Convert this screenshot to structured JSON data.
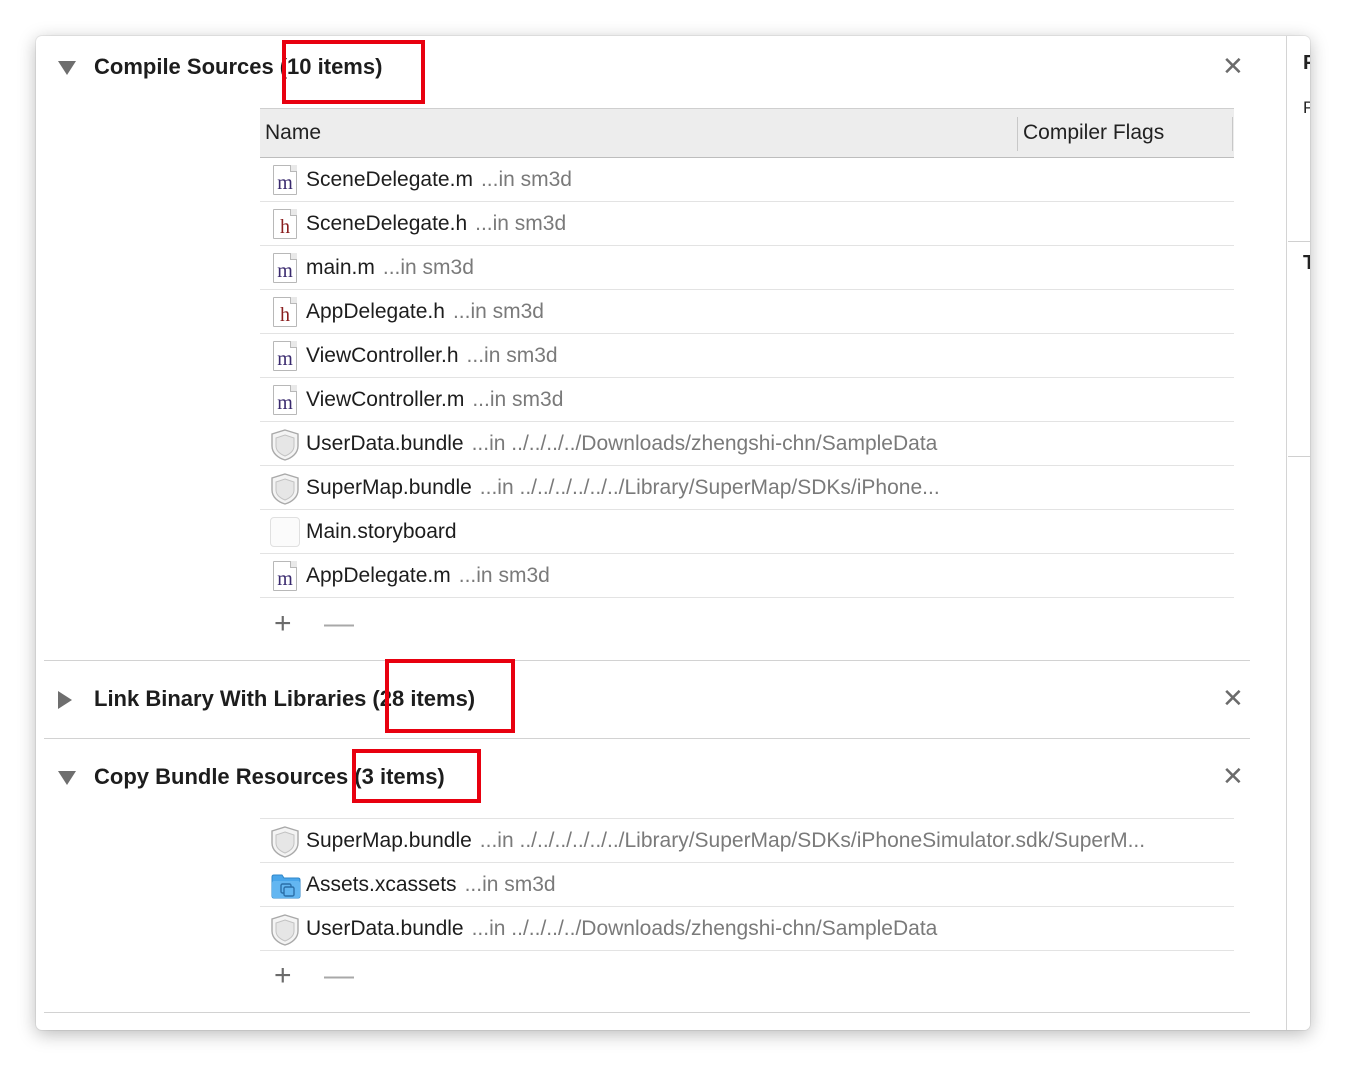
{
  "sections": {
    "compile_sources": {
      "title": "Compile Sources",
      "count": "(10 items)",
      "expanded": true,
      "columns": {
        "name": "Name",
        "compiler_flags": "Compiler Flags"
      },
      "rows": [
        {
          "icon": "objc-m-file-icon",
          "name": "SceneDelegate.m",
          "path": "...in sm3d"
        },
        {
          "icon": "header-h-file-icon",
          "name": "SceneDelegate.h",
          "path": "...in sm3d"
        },
        {
          "icon": "objc-m-file-icon",
          "name": "main.m",
          "path": "...in sm3d"
        },
        {
          "icon": "header-h-file-icon",
          "name": "AppDelegate.h",
          "path": "...in sm3d"
        },
        {
          "icon": "objc-m-file-icon",
          "name": "ViewController.h",
          "path": "...in sm3d"
        },
        {
          "icon": "objc-m-file-icon",
          "name": "ViewController.m",
          "path": "...in sm3d"
        },
        {
          "icon": "bundle-icon",
          "name": "UserData.bundle",
          "path": "...in ../../../../Downloads/zhengshi-chn/SampleData"
        },
        {
          "icon": "bundle-icon",
          "name": "SuperMap.bundle",
          "path": "...in ../../../../../../Library/SuperMap/SDKs/iPhone..."
        },
        {
          "icon": "storyboard-icon",
          "name": "Main.storyboard",
          "path": ""
        },
        {
          "icon": "objc-m-file-icon",
          "name": "AppDelegate.m",
          "path": "...in sm3d"
        }
      ],
      "add_label": "+",
      "remove_label": "—"
    },
    "link_binary": {
      "title": "Link Binary With Libraries",
      "count": "(28 items)",
      "expanded": false
    },
    "copy_bundle": {
      "title": "Copy Bundle Resources",
      "count": "(3 items)",
      "expanded": true,
      "rows": [
        {
          "icon": "bundle-icon",
          "name": "SuperMap.bundle",
          "path": "...in ../../../../../../Library/SuperMap/SDKs/iPhoneSimulator.sdk/SuperM..."
        },
        {
          "icon": "assets-folder-icon",
          "name": "Assets.xcassets",
          "path": "...in sm3d"
        },
        {
          "icon": "bundle-icon",
          "name": "UserData.bundle",
          "path": "...in ../../../../Downloads/zhengshi-chn/SampleData"
        }
      ],
      "add_label": "+",
      "remove_label": "—"
    }
  },
  "close_label": "✕",
  "right_pane": {
    "labels": [
      "P",
      "P",
      "T"
    ]
  },
  "colors": {
    "highlight_box": "#e8000f",
    "m_letter": "#3a2a6e",
    "h_letter": "#8a1e1e"
  }
}
